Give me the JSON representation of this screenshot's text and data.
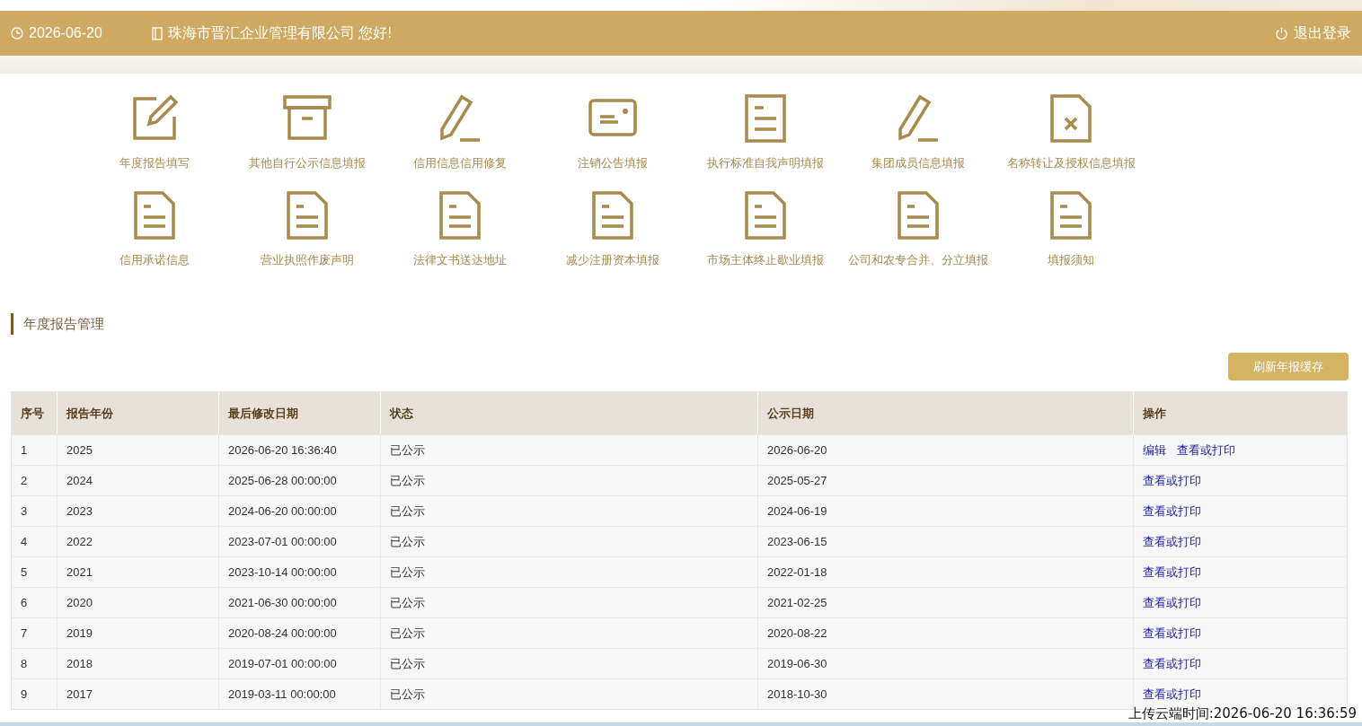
{
  "header": {
    "date": "2026-06-20",
    "greeting": "珠海市晋汇企业管理有限公司 您好!",
    "logout": "退出登录"
  },
  "menu": [
    {
      "label": "年度报告填写"
    },
    {
      "label": "其他自行公示信息填报"
    },
    {
      "label": "信用信息信用修复"
    },
    {
      "label": "注销公告填报"
    },
    {
      "label": "执行标准自我声明填报"
    },
    {
      "label": "集团成员信息填报"
    },
    {
      "label": "名称转让及授权信息填报"
    },
    {
      "label": "信用承诺信息"
    },
    {
      "label": "营业执照作废声明"
    },
    {
      "label": "法律文书送达地址"
    },
    {
      "label": "减少注册资本填报"
    },
    {
      "label": "市场主体终止歇业填报"
    },
    {
      "label": "公司和农专合并、分立填报"
    },
    {
      "label": "填报须知"
    }
  ],
  "section": {
    "title": "年度报告管理",
    "refresh_button": "刷新年报缓存"
  },
  "table": {
    "columns": [
      "序号",
      "报告年份",
      "最后修改日期",
      "状态",
      "公示日期",
      "操作"
    ],
    "rows": [
      {
        "cells": [
          "1",
          "2025",
          "2026-06-20 16:36:40",
          "已公示",
          "2026-06-20"
        ],
        "actions": [
          "编辑",
          "查看或打印"
        ]
      },
      {
        "cells": [
          "2",
          "2024",
          "2025-06-28 00:00:00",
          "已公示",
          "2025-05-27"
        ],
        "actions": [
          "查看或打印"
        ]
      },
      {
        "cells": [
          "3",
          "2023",
          "2024-06-20 00:00:00",
          "已公示",
          "2024-06-19"
        ],
        "actions": [
          "查看或打印"
        ]
      },
      {
        "cells": [
          "4",
          "2022",
          "2023-07-01 00:00:00",
          "已公示",
          "2023-06-15"
        ],
        "actions": [
          "查看或打印"
        ]
      },
      {
        "cells": [
          "5",
          "2021",
          "2023-10-14 00:00:00",
          "已公示",
          "2022-01-18"
        ],
        "actions": [
          "查看或打印"
        ]
      },
      {
        "cells": [
          "6",
          "2020",
          "2021-06-30 00:00:00",
          "已公示",
          "2021-02-25"
        ],
        "actions": [
          "查看或打印"
        ]
      },
      {
        "cells": [
          "7",
          "2019",
          "2020-08-24 00:00:00",
          "已公示",
          "2020-08-22"
        ],
        "actions": [
          "查看或打印"
        ]
      },
      {
        "cells": [
          "8",
          "2018",
          "2019-07-01 00:00:00",
          "已公示",
          "2019-06-30"
        ],
        "actions": [
          "查看或打印"
        ]
      },
      {
        "cells": [
          "9",
          "2017",
          "2019-03-11 00:00:00",
          "已公示",
          "2018-10-30"
        ],
        "actions": [
          "查看或打印"
        ]
      }
    ]
  },
  "upload_time": "上传云端时间:2026-06-20 16:36:59"
}
